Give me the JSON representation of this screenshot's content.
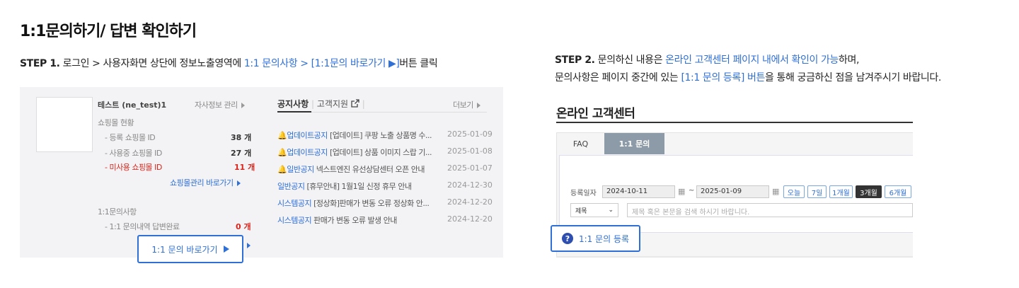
{
  "title": "1:1문의하기/ 답변 확인하기",
  "step1": {
    "label": "STEP 1.",
    "text_a": " 로그인 > 사용자화면 상단에 정보노출영역에 ",
    "highlight": "1:1 문의사항 > [1:1문의 바로가기 ▶]",
    "text_b": "버튼 클릭"
  },
  "step2": {
    "label": "STEP 2.",
    "text_a": " 문의하신 내용은 ",
    "highlight_a": "온라인 고객센터 페이지 내에서 확인이 가능",
    "text_b": "하며,",
    "line2_a": "문의사항은 페이지 중간에 있는  ",
    "highlight_b": "[1:1 문의 등록] 버튼",
    "line2_b": "을 통해 궁금하신 점을 남겨주시기 바랍니다."
  },
  "left_panel": {
    "user_name": "테스트 (ne_test)1",
    "company_link": "자사정보 관리",
    "mall_status": "쇼핑몰 현황",
    "registered_label": "- 등록 쇼핑몰 ID",
    "registered_value": "38 개",
    "active_label": "- 사용중 쇼핑몰 ID",
    "active_value": "27 개",
    "unused_label": "- 미사용 쇼핑몰 ID",
    "unused_value": "11 개",
    "mall_shortcut": "쇼핑몰관리 바로가기",
    "inquiry_section": "1:1문의사항",
    "inquiry_label": "- 1:1 문의내역 답변완료",
    "inquiry_value": "0 개",
    "inquiry_button": "1:1 문의 바로가기",
    "tab_notice": "공지사항",
    "tab_support": "고객지원",
    "more": "더보기",
    "notices": [
      {
        "category": "업데이트공지",
        "title": "[업데이트] 쿠팡 노출 상품명 수...",
        "date": "2025-01-09",
        "bell": true
      },
      {
        "category": "업데이트공지",
        "title": "[업데이트] 상품 이미지 스랍 기...",
        "date": "2025-01-08",
        "bell": true
      },
      {
        "category": "일반공지",
        "title": "넥스트엔진 유선상담센터 오픈 안내",
        "date": "2025-01-07",
        "bell": true
      },
      {
        "category": "일반공지",
        "title": "[휴무안내] 1월1일 신정 휴무 안내",
        "date": "2024-12-30",
        "bell": false
      },
      {
        "category": "시스템공지",
        "title": "[정상화]판매가 변동 오류 정상화 안...",
        "date": "2024-12-20",
        "bell": false
      },
      {
        "category": "시스템공지",
        "title": "판매가 변동 오류 발생 안내",
        "date": "2024-12-20",
        "bell": false
      }
    ]
  },
  "right_panel": {
    "title": "온라인 고객센터",
    "tab_faq": "FAQ",
    "tab_inquiry": "1:1 문의",
    "date_label": "등록일자",
    "date_from": "2024-10-11",
    "tilde": "~",
    "date_to": "2025-01-09",
    "periods": [
      "오늘",
      "7일",
      "1개월",
      "3개월",
      "6개월"
    ],
    "active_period": "3개월",
    "select_value": "제목",
    "search_placeholder": "제목 혹은 본문을 검색 하시기 바랍니다.",
    "register_button": "1:1 문의 등록"
  },
  "colors": {
    "accent": "#2f6fd6",
    "alert": "#d7261e",
    "tab_active": "#8d9aa7"
  }
}
